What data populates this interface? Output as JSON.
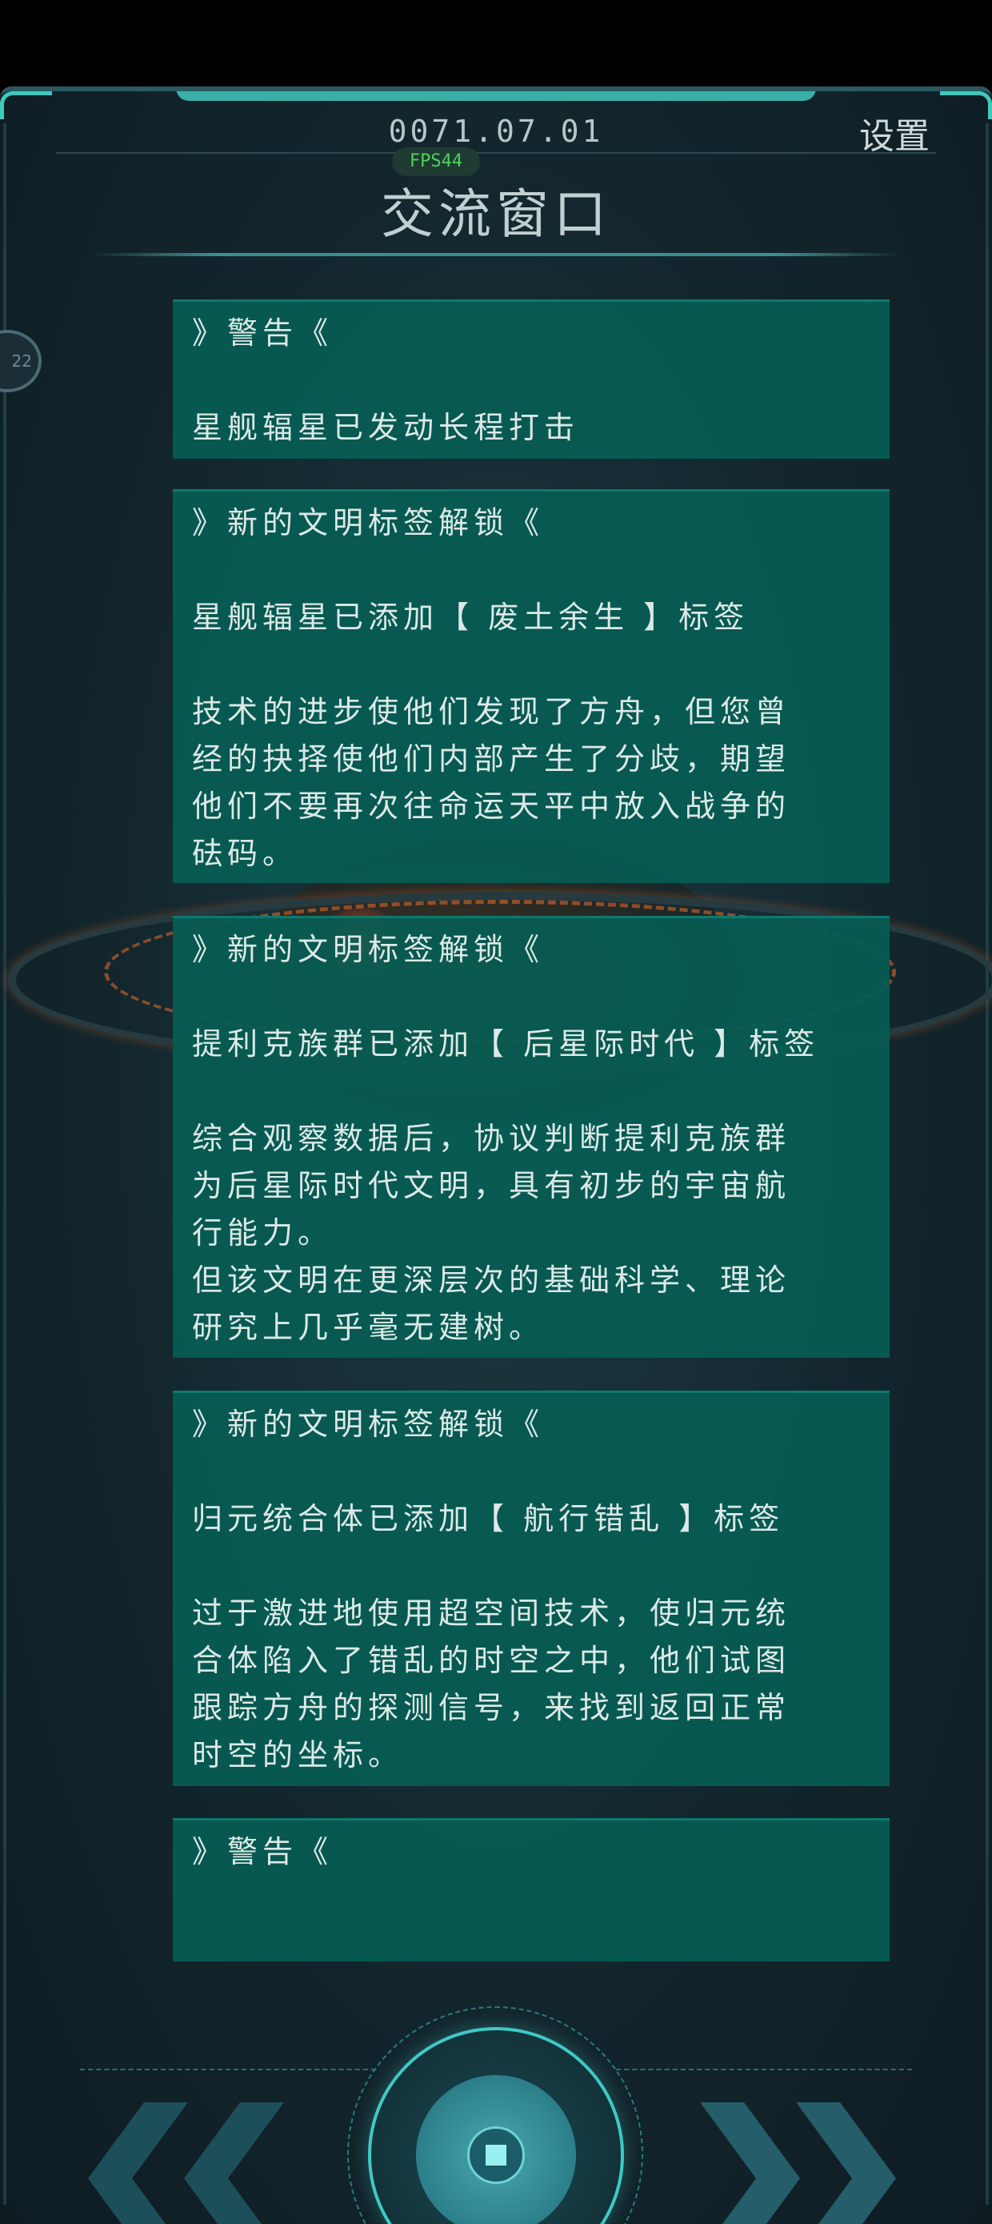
{
  "header": {
    "date": "0071.07.01",
    "settings_label": "设置",
    "fps": "FPS44",
    "title": "交流窗口",
    "side_badge": "22"
  },
  "messages": [
    {
      "heading": "》警告《",
      "lines": [
        "星舰辐星已发动长程打击"
      ]
    },
    {
      "heading": "》新的文明标签解锁《",
      "lines": [
        "星舰辐星已添加【 废土余生 】标签",
        "",
        "技术的进步使他们发现了方舟，但您曾",
        "经的抉择使他们内部产生了分歧，期望",
        "他们不要再次往命运天平中放入战争的",
        "砝码。"
      ]
    },
    {
      "heading": "》新的文明标签解锁《",
      "lines": [
        "提利克族群已添加【 后星际时代 】标签",
        "",
        "综合观察数据后，协议判断提利克族群",
        "为后星际时代文明，具有初步的宇宙航",
        "行能力。",
        "但该文明在更深层次的基础科学、理论",
        "研究上几乎毫无建树。"
      ]
    },
    {
      "heading": "》新的文明标签解锁《",
      "lines": [
        "归元统合体已添加【 航行错乱 】标签",
        "",
        "过于激进地使用超空间技术，使归元统",
        "合体陷入了错乱的时空之中，他们试图",
        "跟踪方舟的探测信号，来找到返回正常",
        "时空的坐标。"
      ]
    },
    {
      "heading": "》警告《",
      "lines": []
    }
  ],
  "controls": {
    "prev_icon": "double-chevron-left-icon",
    "next_icon": "double-chevron-right-icon",
    "center_icon": "target-button-icon"
  }
}
